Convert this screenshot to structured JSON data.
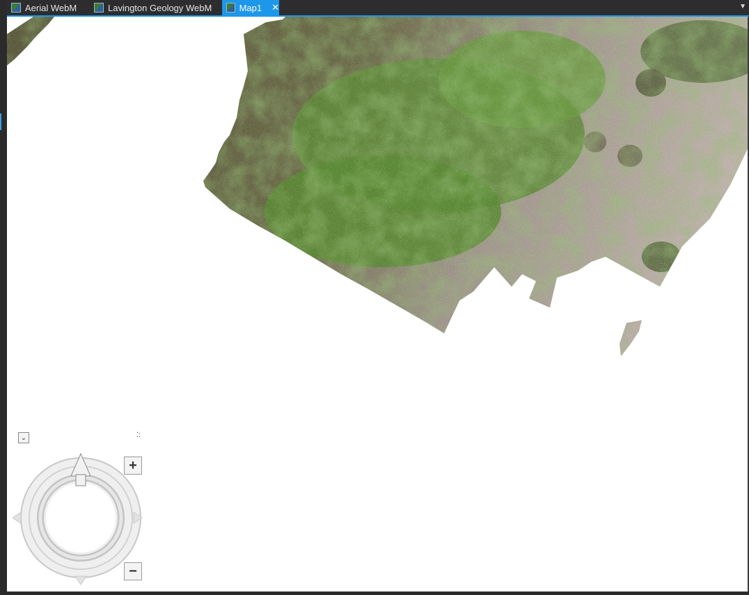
{
  "tabs": [
    {
      "label": "Aerial WebM",
      "active": false
    },
    {
      "label": "Lavington Geology WebM",
      "active": false
    },
    {
      "label": "Map1",
      "active": true
    }
  ],
  "tab_close_glyph": "✕",
  "tab_icon": "map-layer-icon",
  "overflow_glyph": "▼",
  "nav": {
    "dropdown_glyph": "⌄",
    "grip_glyph": "⁚:",
    "zoom_in_label": "+",
    "zoom_out_label": "−"
  },
  "colors": {
    "accent": "#1c97ea",
    "map_background": "#ffffff",
    "vegetation": "#4f7d32",
    "bare_ground": "#b8aca3"
  }
}
